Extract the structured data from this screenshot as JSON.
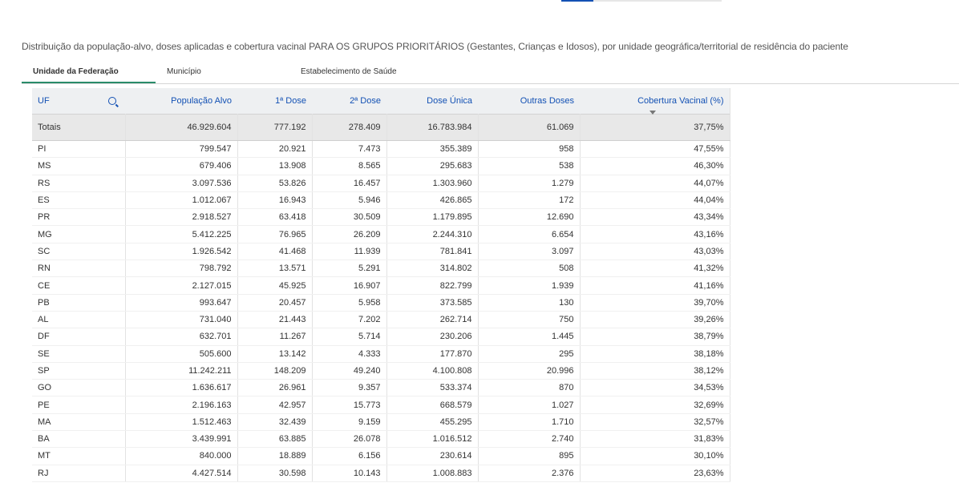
{
  "title": "Distribuição da população-alvo, doses aplicadas e cobertura vacinal PARA OS GRUPOS PRIORITÁRIOS (Gestantes, Crianças e Idosos), por unidade geográfica/territorial de residência do paciente",
  "tabs": [
    {
      "label": "Unidade da Federação"
    },
    {
      "label": "Município"
    },
    {
      "label": "Estabelecimento de Saúde"
    }
  ],
  "columns": [
    "UF",
    "População Alvo",
    "1ª Dose",
    "2ª Dose",
    "Dose Única",
    "Outras Doses",
    "Cobertura Vacinal (%)"
  ],
  "totals": {
    "uf": "Totais",
    "pop": "46.929.604",
    "d1": "777.192",
    "d2": "278.409",
    "du": "16.783.984",
    "od": "61.069",
    "cov": "37,75%"
  },
  "rows": [
    {
      "uf": "PI",
      "pop": "799.547",
      "d1": "20.921",
      "d2": "7.473",
      "du": "355.389",
      "od": "958",
      "cov": "47,55%"
    },
    {
      "uf": "MS",
      "pop": "679.406",
      "d1": "13.908",
      "d2": "8.565",
      "du": "295.683",
      "od": "538",
      "cov": "46,30%"
    },
    {
      "uf": "RS",
      "pop": "3.097.536",
      "d1": "53.826",
      "d2": "16.457",
      "du": "1.303.960",
      "od": "1.279",
      "cov": "44,07%"
    },
    {
      "uf": "ES",
      "pop": "1.012.067",
      "d1": "16.943",
      "d2": "5.946",
      "du": "426.865",
      "od": "172",
      "cov": "44,04%"
    },
    {
      "uf": "PR",
      "pop": "2.918.527",
      "d1": "63.418",
      "d2": "30.509",
      "du": "1.179.895",
      "od": "12.690",
      "cov": "43,34%"
    },
    {
      "uf": "MG",
      "pop": "5.412.225",
      "d1": "76.965",
      "d2": "26.209",
      "du": "2.244.310",
      "od": "6.654",
      "cov": "43,16%"
    },
    {
      "uf": "SC",
      "pop": "1.926.542",
      "d1": "41.468",
      "d2": "11.939",
      "du": "781.841",
      "od": "3.097",
      "cov": "43,03%"
    },
    {
      "uf": "RN",
      "pop": "798.792",
      "d1": "13.571",
      "d2": "5.291",
      "du": "314.802",
      "od": "508",
      "cov": "41,32%"
    },
    {
      "uf": "CE",
      "pop": "2.127.015",
      "d1": "45.925",
      "d2": "16.907",
      "du": "822.799",
      "od": "1.939",
      "cov": "41,16%"
    },
    {
      "uf": "PB",
      "pop": "993.647",
      "d1": "20.457",
      "d2": "5.958",
      "du": "373.585",
      "od": "130",
      "cov": "39,70%"
    },
    {
      "uf": "AL",
      "pop": "731.040",
      "d1": "21.443",
      "d2": "7.202",
      "du": "262.714",
      "od": "750",
      "cov": "39,26%"
    },
    {
      "uf": "DF",
      "pop": "632.701",
      "d1": "11.267",
      "d2": "5.714",
      "du": "230.206",
      "od": "1.445",
      "cov": "38,79%"
    },
    {
      "uf": "SE",
      "pop": "505.600",
      "d1": "13.142",
      "d2": "4.333",
      "du": "177.870",
      "od": "295",
      "cov": "38,18%"
    },
    {
      "uf": "SP",
      "pop": "11.242.211",
      "d1": "148.209",
      "d2": "49.240",
      "du": "4.100.808",
      "od": "20.996",
      "cov": "38,12%"
    },
    {
      "uf": "GO",
      "pop": "1.636.617",
      "d1": "26.961",
      "d2": "9.357",
      "du": "533.374",
      "od": "870",
      "cov": "34,53%"
    },
    {
      "uf": "PE",
      "pop": "2.196.163",
      "d1": "42.957",
      "d2": "15.773",
      "du": "668.579",
      "od": "1.027",
      "cov": "32,69%"
    },
    {
      "uf": "MA",
      "pop": "1.512.463",
      "d1": "32.439",
      "d2": "9.159",
      "du": "455.295",
      "od": "1.710",
      "cov": "32,57%"
    },
    {
      "uf": "BA",
      "pop": "3.439.991",
      "d1": "63.885",
      "d2": "26.078",
      "du": "1.016.512",
      "od": "2.740",
      "cov": "31,83%"
    },
    {
      "uf": "MT",
      "pop": "840.000",
      "d1": "18.889",
      "d2": "6.156",
      "du": "230.614",
      "od": "895",
      "cov": "30,10%"
    },
    {
      "uf": "RJ",
      "pop": "4.427.514",
      "d1": "30.598",
      "d2": "10.143",
      "du": "1.008.883",
      "od": "2.376",
      "cov": "23,63%"
    }
  ],
  "icons": {
    "search": "search-icon",
    "sort": "sort-desc-icon"
  },
  "colors": {
    "accent": "#1351b4",
    "active_tab": "#2a8c6a",
    "header_bg": "#eef0f2",
    "totals_bg": "#e8e8e8"
  }
}
